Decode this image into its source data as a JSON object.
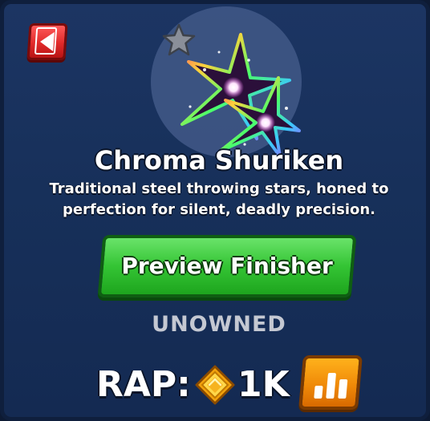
{
  "item": {
    "name": "Chroma Shuriken",
    "description": "Traditional steel throwing stars, honed to perfection for silent, deadly precision.",
    "status": "UNOWNED",
    "rarity_icon": "star-icon"
  },
  "actions": {
    "back_icon": "back-arrow-icon",
    "preview_label": "Preview Finisher",
    "chart_icon": "bar-chart-icon"
  },
  "rap": {
    "label": "RAP:",
    "currency_icon": "coin-icon",
    "value": "1K"
  },
  "colors": {
    "panel": "#17305a",
    "back_button": "#e12a2a",
    "preview_button": "#34c434",
    "chart_button": "#f08a08",
    "status_text": "#c4c8d2"
  }
}
